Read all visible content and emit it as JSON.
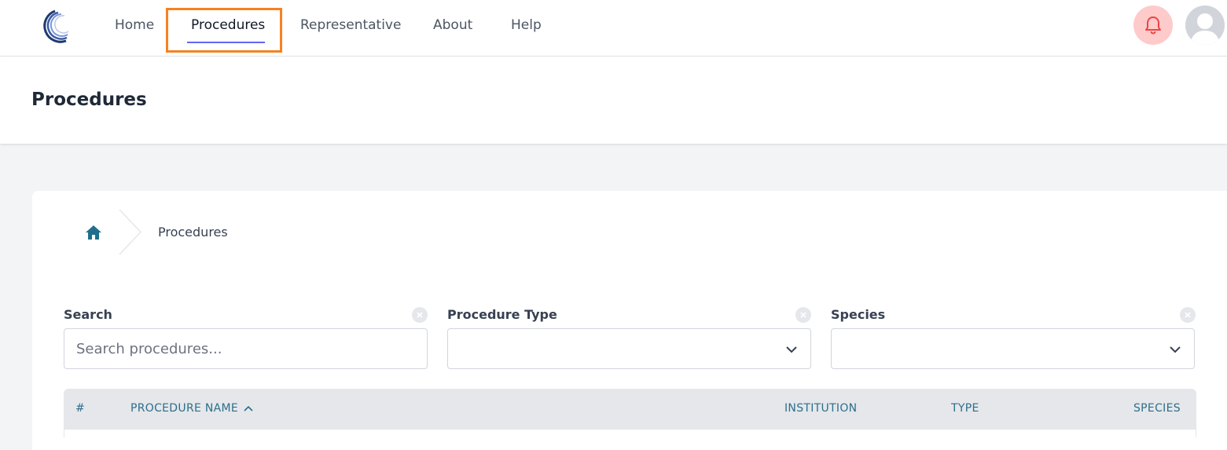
{
  "nav": {
    "items": [
      {
        "label": "Home"
      },
      {
        "label": "Procedures"
      },
      {
        "label": "Representative"
      },
      {
        "label": "About"
      },
      {
        "label": "Help"
      }
    ],
    "active": "Procedures"
  },
  "colors": {
    "accent_underline": "#6366f1",
    "highlight": "#f58220",
    "bell_bg": "#fecaca",
    "bell_icon": "#ef4444",
    "header_text": "#2c6f8a"
  },
  "page": {
    "title": "Procedures"
  },
  "breadcrumb": {
    "home_icon": "home-icon",
    "current": "Procedures"
  },
  "filters": {
    "search": {
      "label": "Search",
      "placeholder": "Search procedures...",
      "value": ""
    },
    "procedure_type": {
      "label": "Procedure Type",
      "value": ""
    },
    "species": {
      "label": "Species",
      "value": ""
    }
  },
  "table": {
    "columns": {
      "index": "#",
      "name": "PROCEDURE NAME",
      "institution": "INSTITUTION",
      "type": "TYPE",
      "species": "SPECIES"
    }
  }
}
